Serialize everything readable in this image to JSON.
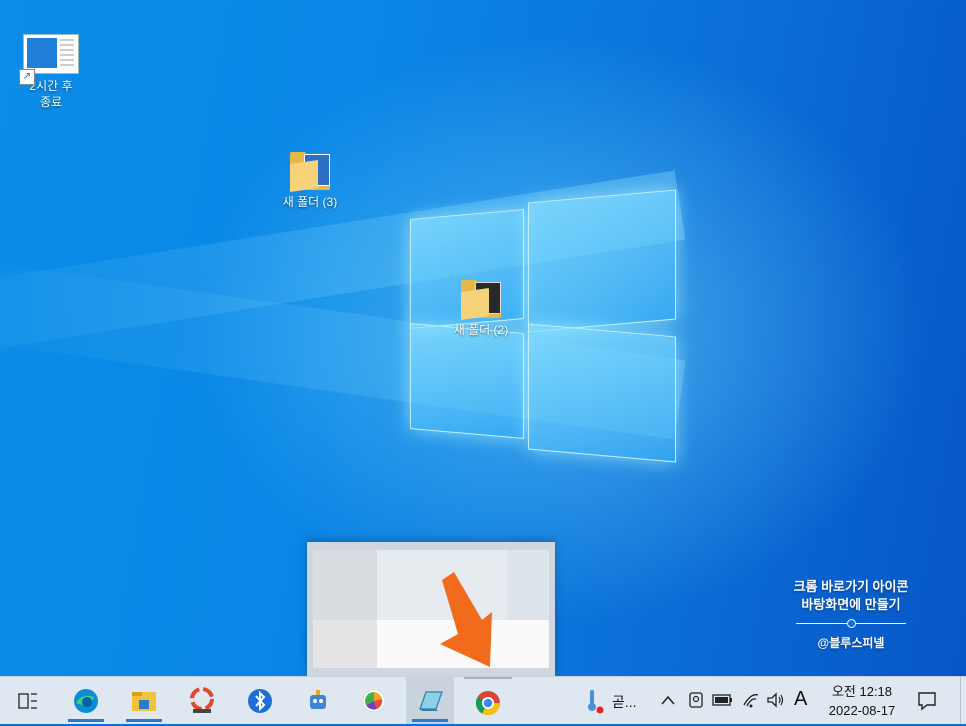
{
  "desktop": {
    "icons": [
      {
        "label": "2시간 후\n종료",
        "type": "shortcut"
      },
      {
        "label": "새 폴더 (3)",
        "type": "folder"
      },
      {
        "label": "새 폴더 (2)",
        "type": "folder"
      }
    ]
  },
  "watermark": {
    "line1": "크롬 바로가기 아이콘",
    "line2": "바탕화면에 만들기",
    "handle": "@블루스피넬"
  },
  "taskbar": {
    "apps": [
      {
        "name": "task-view-icon",
        "running": false
      },
      {
        "name": "edge-icon",
        "running": true
      },
      {
        "name": "file-explorer-icon",
        "running": true
      },
      {
        "name": "photoscape-icon",
        "running": false
      },
      {
        "name": "bluetooth-icon",
        "running": false
      },
      {
        "name": "settings-robot-icon",
        "running": false
      },
      {
        "name": "color-wheel-icon",
        "running": false
      },
      {
        "name": "notes-app-icon",
        "running": true
      },
      {
        "name": "chrome-icon",
        "running": false
      }
    ],
    "weather_text": "곧...",
    "ime_label": "A",
    "clock": {
      "time": "오전 12:18",
      "date": "2022-08-17"
    }
  },
  "colors": {
    "accent": "#2b79d2",
    "annotation_arrow": "#f26b1d",
    "taskbar_bg": "#dfe7f0"
  }
}
